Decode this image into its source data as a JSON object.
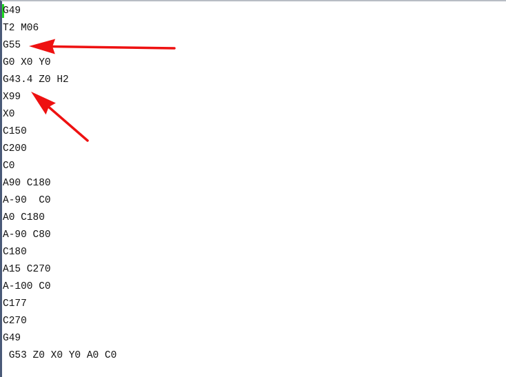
{
  "lines": [
    "G49",
    "T2 M06",
    "G55",
    "G0 X0 Y0",
    "G43.4 Z0 H2",
    "X99",
    "X0",
    "C150",
    "C200",
    "C0",
    "A90 C180",
    "A-90  C0",
    "A0 C180",
    "A-90 C80",
    "C180",
    "A15 C270",
    "A-100 C0",
    "C177",
    "C270",
    "G49",
    " G53 Z0 X0 Y0 A0 C0"
  ],
  "annotation_color": "#ee1111",
  "annotations": [
    "arrow pointing to G55",
    "arrow pointing to G43.4 Z0 H2"
  ]
}
